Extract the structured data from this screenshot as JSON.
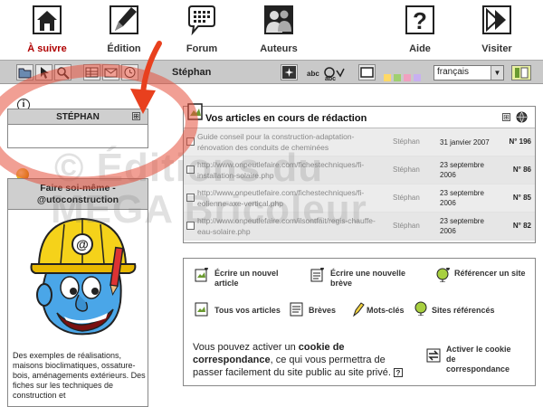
{
  "nav": {
    "items": [
      {
        "label": "À suivre",
        "icon": "house-icon"
      },
      {
        "label": "Édition",
        "icon": "pen-icon"
      },
      {
        "label": "Forum",
        "icon": "speech-bubble-icon"
      },
      {
        "label": "Auteurs",
        "icon": "people-icon"
      },
      {
        "label": "Aide",
        "icon": "help-icon"
      },
      {
        "label": "Visiter",
        "icon": "arrow-right-icon"
      }
    ]
  },
  "toolbar": {
    "author_name": "Stéphan",
    "language": "français",
    "colors": [
      "#ffd966",
      "#a0d070",
      "#f0a0c0",
      "#c8b0f0"
    ]
  },
  "sidebar": {
    "info_symbol": "i",
    "author_box_title": "STÉPHAN",
    "toggle_symbol": "⊞",
    "auto_box_title_line1": "Faire soi-même -",
    "auto_box_title_line2": "@utoconstruction",
    "auto_box_text": "Des exemples de réalisations, maisons bioclimatiques, ossature-bois, aménagements extérieurs. Des fiches sur les techniques de construction et"
  },
  "articles": {
    "title": "Vos articles en cours de rédaction",
    "rows": [
      {
        "title": "Guide conseil pour la construction-adaptation-rénovation des conduits de cheminées",
        "author": "Stéphan",
        "date": "31 janvier 2007",
        "number": "N° 196"
      },
      {
        "title": "http://www.onpeutlefaire.com/fichestechniques/fi-installation-solaire.php",
        "author": "Stéphan",
        "date": "23 septembre 2006",
        "number": "N° 86"
      },
      {
        "title": "http://www.onpeutlefaire.com/fichestechniques/fi-eolienne-axe-vertical.php",
        "author": "Stéphan",
        "date": "23 septembre 2006",
        "number": "N° 85"
      },
      {
        "title": "http://www.onpeutlefaire.com/ilsontfait/regis-chauffe-eau-solaire.php",
        "author": "Stéphan",
        "date": "23 septembre 2006",
        "number": "N° 82"
      }
    ]
  },
  "actions": {
    "new_article": "Écrire un nouvel article",
    "new_brief": "Écrire une nouvelle brève",
    "reference_site": "Référencer un site",
    "all_articles": "Tous vos articles",
    "briefs": "Brèves",
    "keywords": "Mots-clés",
    "referenced_sites": "Sites référencés",
    "cookie_before": "Vous pouvez activer un ",
    "cookie_bold": "cookie de correspondance",
    "cookie_after": ", ce qui vous permettra de passer facilement du site public au site privé.",
    "help_symbol": "?",
    "activate_cookie": "Activer le cookie de correspondance"
  },
  "watermark": {
    "line1": "© Éditions du",
    "line2": "MEGA Bricoleur"
  }
}
